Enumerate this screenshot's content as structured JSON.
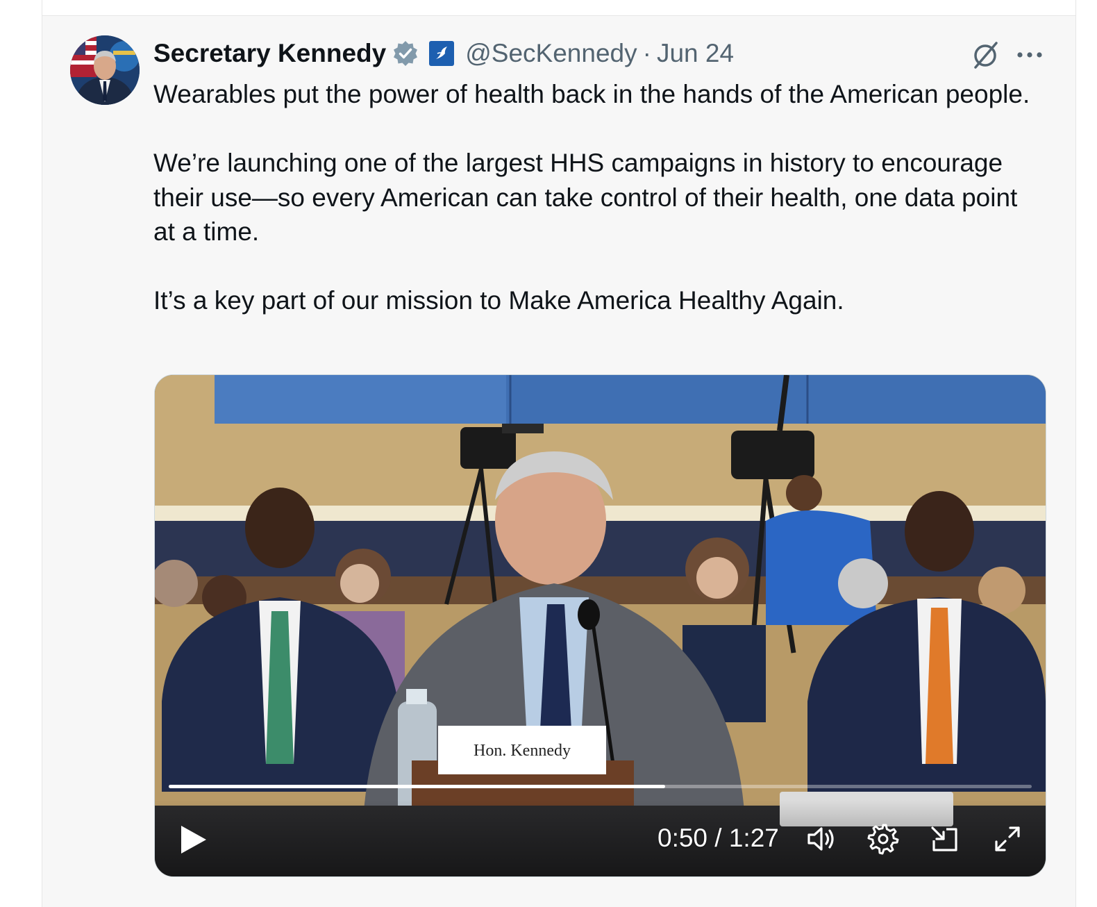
{
  "tweet": {
    "author_name": "Secretary Kennedy",
    "handle": "@SecKennedy",
    "separator": "·",
    "date": "Jun 24",
    "paragraphs": [
      "Wearables put the power of health back in the hands of the American people.",
      "We’re launching one of the largest HHS campaigns in history to encourage their use—so every American can take control of their health, one data point at a time.",
      "It’s a key part of our mission to Make America Healthy Again."
    ]
  },
  "icons": {
    "verified": "verified-badge-icon",
    "affiliation": "hhs-affiliate-badge-icon",
    "grok": "grok-icon",
    "more": "more-options-icon"
  },
  "video": {
    "placard_text": "Hon. Kennedy",
    "current_time": "0:50",
    "time_separator": " / ",
    "duration": "1:27",
    "progress_fraction": 0.575
  },
  "colors": {
    "verified_badge": "#829aab",
    "affiliate_badge": "#1d5fb0",
    "handle_text": "#536471",
    "name_text": "#0f1419",
    "card_background": "#f7f7f7"
  }
}
